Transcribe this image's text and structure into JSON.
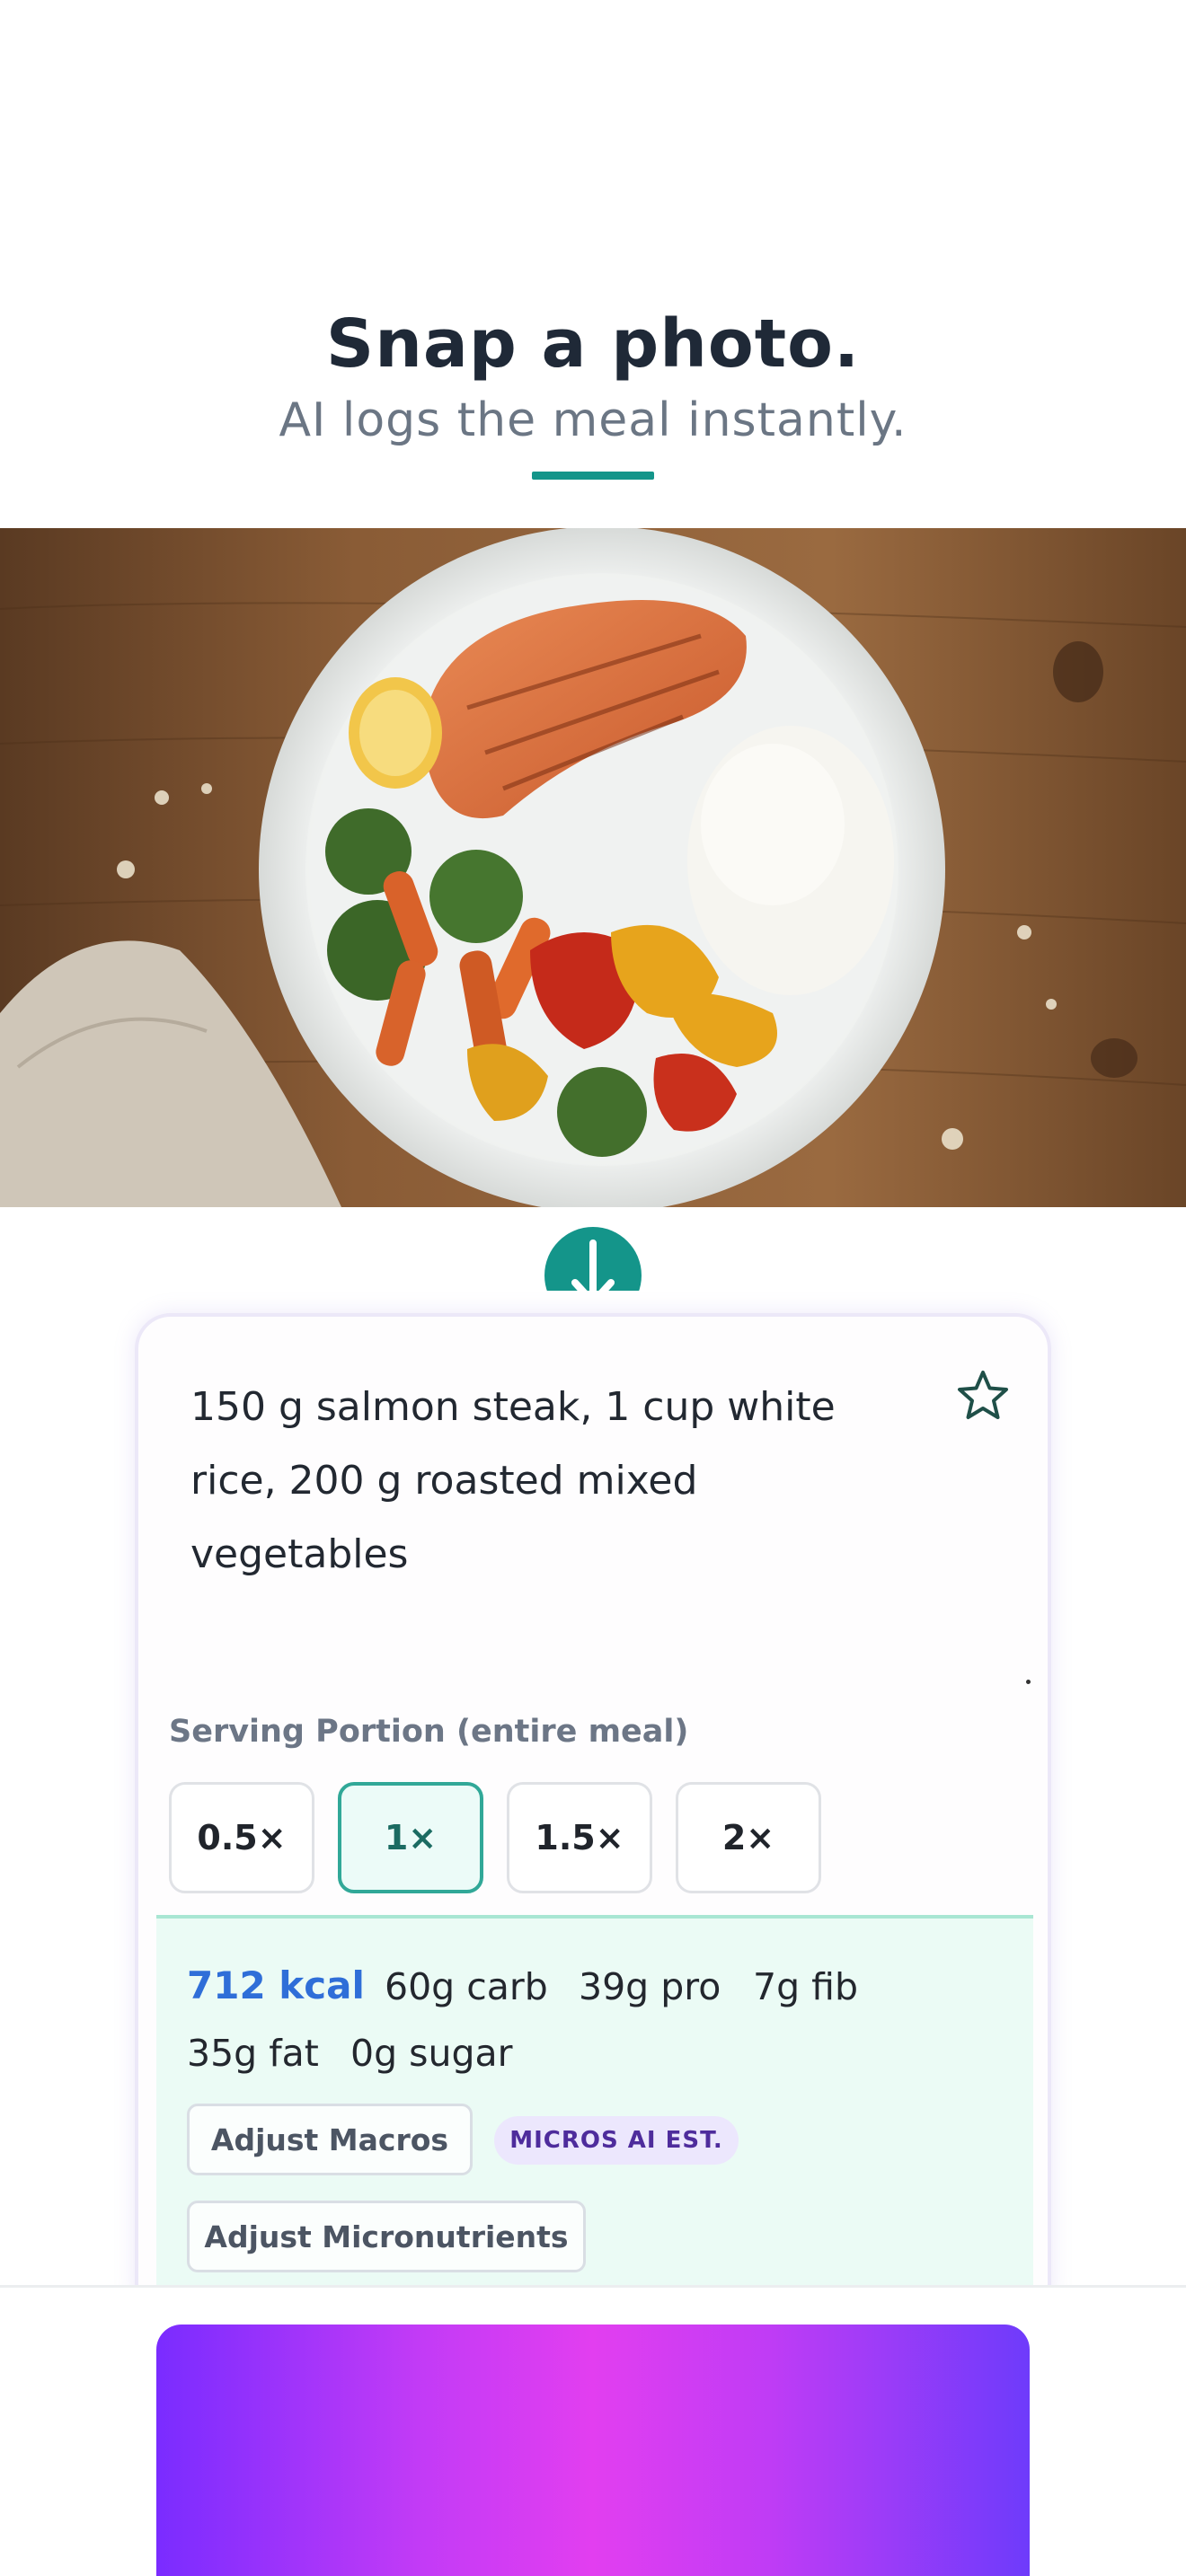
{
  "hero": {
    "title": "Snap a photo.",
    "subtitle": "AI logs the meal instantly."
  },
  "photo": {
    "icon": "meal-photo"
  },
  "entry": {
    "meal_text": "150 g salmon steak, 1 cup white rice, 200 g roasted mixed vegetables",
    "favorite_icon": "star-outline-icon"
  },
  "portion": {
    "label": "Serving Portion (entire meal)",
    "options": [
      "0.5×",
      "1×",
      "1.5×",
      "2×"
    ],
    "selected": "1×"
  },
  "nutrition": {
    "kcal": "712 kcal",
    "carb": "60g carb",
    "pro": "39g pro",
    "fib": "7g fib",
    "fat": "35g fat",
    "sugar": "0g sugar",
    "adjust_macros": "Adjust Macros",
    "micros_badge": "MICROS AI EST.",
    "adjust_micros": "Adjust Micronutrients"
  },
  "colors": {
    "accent": "#14958a",
    "kcal": "#2f6ed8",
    "badge_bg": "#ece7fd",
    "badge_text": "#4e2c9c",
    "cta_gradient_start": "#7a2cff",
    "cta_gradient_mid": "#e23ef0"
  }
}
